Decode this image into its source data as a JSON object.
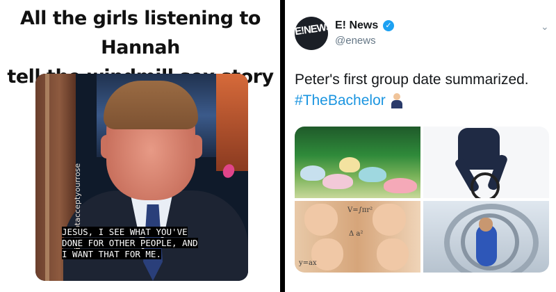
{
  "meme": {
    "caption_line1": "All the girls listening to Hannah",
    "caption_line2": "tell the windmill sex story",
    "watermark": "@iwillnotacceptyourrose",
    "subtitle_line1": "JESUS, I SEE WHAT YOU'VE",
    "subtitle_line2": "DONE FOR OTHER PEOPLE, AND",
    "subtitle_line3": "I WANT THAT FOR ME."
  },
  "tweet": {
    "avatar_text": "E!NEWS",
    "display_name": "E! News",
    "handle": "@enews",
    "text": "Peter's first group date summarized.",
    "hashtag": "#TheBachelor",
    "accent_color": "#1b95e0",
    "icons": [
      "verified-badge-icon",
      "chevron-down-icon",
      "man-in-suit-emoji"
    ]
  }
}
